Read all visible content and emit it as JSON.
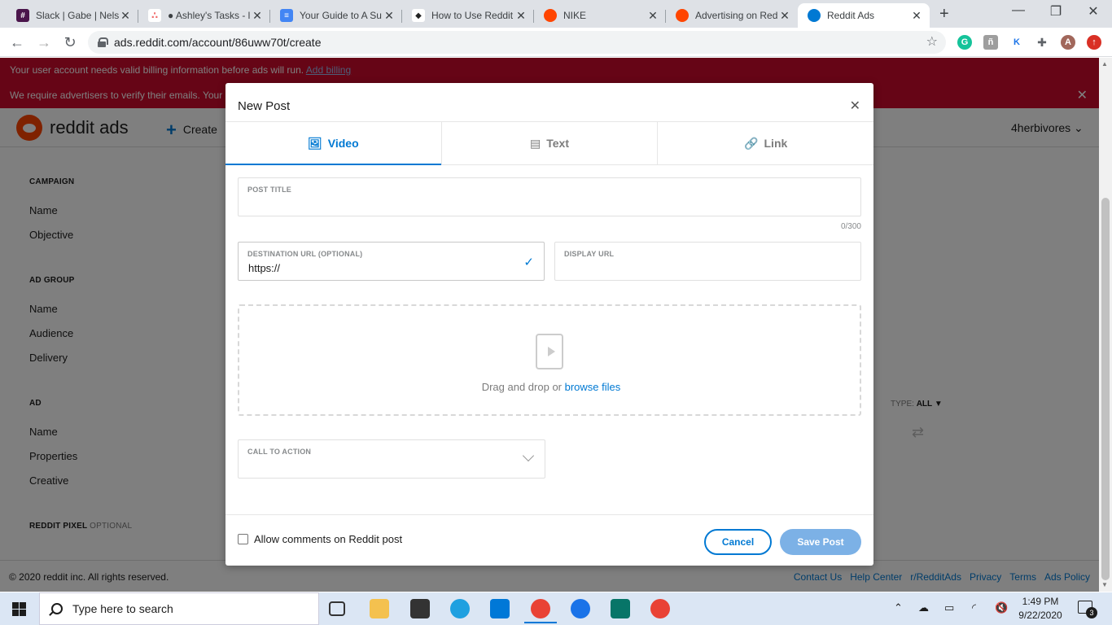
{
  "browser": {
    "tabs": [
      {
        "title": "Slack | Gabe | Nels",
        "fav_color": "#4a154b",
        "fav_glyph": "#"
      },
      {
        "title": "● Ashley's Tasks - l",
        "fav_color": "#f06a6a",
        "fav_glyph": "∴"
      },
      {
        "title": "Your Guide to A Su",
        "fav_color": "#4285f4",
        "fav_glyph": "≡"
      },
      {
        "title": "How to Use Reddit",
        "fav_color": "#222222",
        "fav_glyph": "◆"
      },
      {
        "title": "NIKE",
        "fav_color": "#ff4500",
        "fav_glyph": "●"
      },
      {
        "title": "Advertising on Red",
        "fav_color": "#ff4500",
        "fav_glyph": "●"
      },
      {
        "title": "Reddit Ads",
        "fav_color": "#0079d3",
        "fav_glyph": "●"
      }
    ],
    "url": "ads.reddit.com/account/86uww70t/create",
    "profile_initial": "A"
  },
  "banners": {
    "billing_text": "Your user account needs valid billing information before ads will run.",
    "billing_link": "Add billing",
    "verify_text": "We require advertisers to verify their emails. Your a"
  },
  "header": {
    "logo_text": "reddit ads",
    "create_label": "Create",
    "account_label": "4herbivores ⌄"
  },
  "sidebar": {
    "campaign": {
      "heading": "CAMPAIGN",
      "items": [
        "Name",
        "Objective"
      ]
    },
    "ad_group": {
      "heading": "AD GROUP",
      "items": [
        "Name",
        "Audience",
        "Delivery"
      ]
    },
    "ad": {
      "heading": "AD",
      "items": [
        "Name",
        "Properties",
        "Creative"
      ]
    },
    "pixel": {
      "heading": "REDDIT PIXEL",
      "optional": "OPTIONAL"
    }
  },
  "filter": {
    "label": "TYPE:",
    "value": "ALL"
  },
  "footer": {
    "copyright": "© 2020 reddit inc. All rights reserved.",
    "links": [
      "Contact Us",
      "Help Center",
      "r/RedditAds",
      "Privacy",
      "Terms",
      "Ads Policy"
    ]
  },
  "modal": {
    "title": "New Post",
    "tabs": [
      {
        "label": "Video",
        "icon": "image-icon",
        "active": true
      },
      {
        "label": "Text",
        "icon": "comment-icon",
        "active": false
      },
      {
        "label": "Link",
        "icon": "link-icon",
        "active": false
      }
    ],
    "post_title": {
      "label": "POST TITLE",
      "value": "",
      "counter": "0/300"
    },
    "destination_url": {
      "label": "DESTINATION URL (OPTIONAL)",
      "value": "https://"
    },
    "display_url": {
      "label": "DISPLAY URL",
      "value": ""
    },
    "dropzone": {
      "text": "Drag and drop or",
      "link": "browse files"
    },
    "call_to_action": {
      "label": "CALL TO ACTION",
      "value": ""
    },
    "allow_comments_label": "Allow comments on Reddit post",
    "allow_comments_checked": false,
    "cancel_label": "Cancel",
    "save_label": "Save Post"
  },
  "taskbar": {
    "search_placeholder": "Type here to search",
    "time": "1:49 PM",
    "date": "9/22/2020",
    "notifications": "3"
  }
}
